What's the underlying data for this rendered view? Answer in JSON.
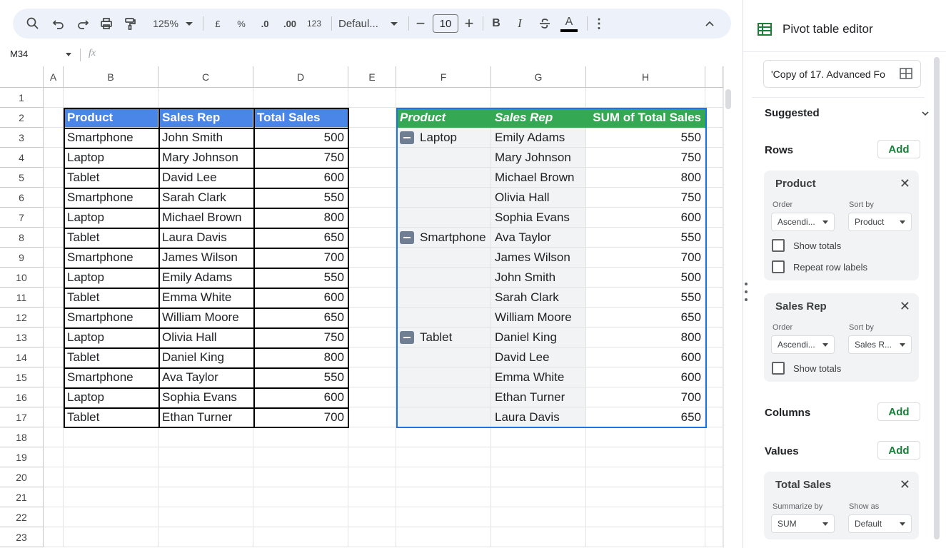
{
  "toolbar": {
    "zoom": "125%",
    "currency": "£",
    "percent": "%",
    "dec_decrease": ".0",
    "dec_increase": ".00",
    "number_format": "123",
    "font": "Defaul...",
    "font_size": "10",
    "bold": "B",
    "italic": "I",
    "text_color": "A"
  },
  "formula_bar": {
    "name_box": "M34",
    "fx": "fx",
    "value": ""
  },
  "grid": {
    "columns": [
      "A",
      "B",
      "C",
      "D",
      "E",
      "F",
      "G",
      "H"
    ],
    "rows": [
      "1",
      "2",
      "3",
      "4",
      "5",
      "6",
      "7",
      "8",
      "9",
      "10",
      "11",
      "12",
      "13",
      "14",
      "15",
      "16",
      "17",
      "18",
      "19",
      "20",
      "21",
      "22",
      "23"
    ]
  },
  "source_table": {
    "headers": [
      "Product",
      "Sales Rep",
      "Total Sales"
    ],
    "rows": [
      [
        "Smartphone",
        "John Smith",
        "500"
      ],
      [
        "Laptop",
        "Mary Johnson",
        "750"
      ],
      [
        "Tablet",
        "David Lee",
        "600"
      ],
      [
        "Smartphone",
        "Sarah Clark",
        "550"
      ],
      [
        "Laptop",
        "Michael Brown",
        "800"
      ],
      [
        "Tablet",
        "Laura Davis",
        "650"
      ],
      [
        "Smartphone",
        "James Wilson",
        "700"
      ],
      [
        "Laptop",
        "Emily Adams",
        "550"
      ],
      [
        "Tablet",
        "Emma White",
        "600"
      ],
      [
        "Smartphone",
        "William Moore",
        "650"
      ],
      [
        "Laptop",
        "Olivia Hall",
        "750"
      ],
      [
        "Tablet",
        "Daniel King",
        "800"
      ],
      [
        "Smartphone",
        "Ava Taylor",
        "550"
      ],
      [
        "Laptop",
        "Sophia Evans",
        "600"
      ],
      [
        "Tablet",
        "Ethan Turner",
        "700"
      ]
    ]
  },
  "pivot_table": {
    "headers": [
      "Product",
      "Sales Rep",
      "SUM of Total Sales"
    ],
    "rows": [
      [
        "Laptop",
        "Emily Adams",
        "550"
      ],
      [
        "",
        "Mary Johnson",
        "750"
      ],
      [
        "",
        "Michael Brown",
        "800"
      ],
      [
        "",
        "Olivia Hall",
        "750"
      ],
      [
        "",
        "Sophia Evans",
        "600"
      ],
      [
        "Smartphone",
        "Ava Taylor",
        "550"
      ],
      [
        "",
        "James Wilson",
        "700"
      ],
      [
        "",
        "John Smith",
        "500"
      ],
      [
        "",
        "Sarah Clark",
        "550"
      ],
      [
        "",
        "William Moore",
        "650"
      ],
      [
        "Tablet",
        "Daniel King",
        "800"
      ],
      [
        "",
        "David Lee",
        "600"
      ],
      [
        "",
        "Emma White",
        "600"
      ],
      [
        "",
        "Ethan Turner",
        "700"
      ],
      [
        "",
        "Laura Davis",
        "650"
      ]
    ]
  },
  "editor": {
    "title": "Pivot table editor",
    "range": "'Copy of 17. Advanced Fo",
    "suggested": "Suggested",
    "rows_label": "Rows",
    "columns_label": "Columns",
    "values_label": "Values",
    "add": "Add",
    "cards": [
      {
        "title": "Product",
        "order_label": "Order",
        "order": "Ascendi...",
        "sort_label": "Sort by",
        "sort": "Product",
        "checks": [
          "Show totals",
          "Repeat row labels"
        ]
      },
      {
        "title": "Sales Rep",
        "order_label": "Order",
        "order": "Ascendi...",
        "sort_label": "Sort by",
        "sort": "Sales R...",
        "checks": [
          "Show totals"
        ]
      }
    ],
    "values_card": {
      "title": "Total Sales",
      "summarize_label": "Summarize by",
      "summarize": "SUM",
      "show_label": "Show as",
      "show": "Default"
    }
  },
  "colors": {
    "source_header_bg": "#4a86e8",
    "pivot_header_bg": "#34a853",
    "accent_green": "#188038",
    "selection_blue": "#1a73e8"
  }
}
